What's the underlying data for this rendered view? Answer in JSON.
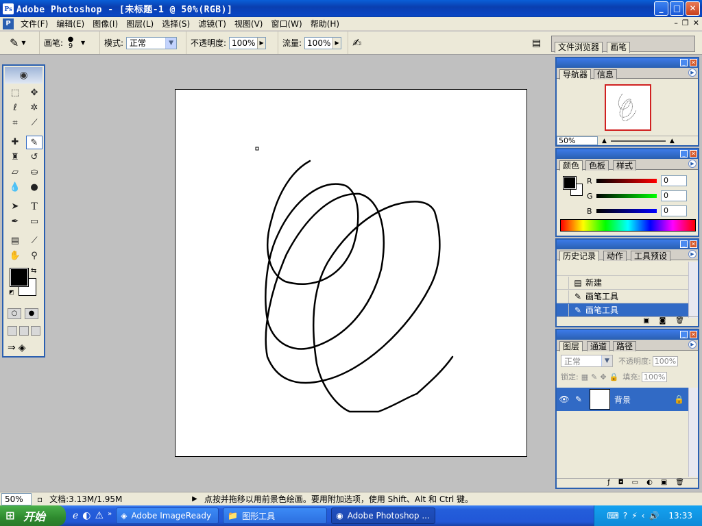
{
  "window": {
    "title": "Adobe Photoshop - [未标题-1 @ 50%(RGB)]",
    "min": "_",
    "max": "□",
    "close": "✕"
  },
  "menu": {
    "items": [
      "文件(F)",
      "编辑(E)",
      "图像(I)",
      "图层(L)",
      "选择(S)",
      "滤镜(T)",
      "视图(V)",
      "窗口(W)",
      "帮助(H)"
    ]
  },
  "options": {
    "brush_label": "画笔:",
    "brush_size": "9",
    "mode_label": "模式:",
    "mode_value": "正常",
    "opacity_label": "不透明度:",
    "opacity_value": "100%",
    "flow_label": "流量:",
    "flow_value": "100%"
  },
  "palette_well": {
    "tabs": [
      "文件浏览器",
      "画笔"
    ]
  },
  "navigator": {
    "tabs": [
      "导航器",
      "信息"
    ],
    "zoom": "50%"
  },
  "color": {
    "tabs": [
      "颜色",
      "色板",
      "样式"
    ],
    "channels": [
      {
        "label": "R",
        "value": "0",
        "color": "#ff0000"
      },
      {
        "label": "G",
        "value": "0",
        "color": "#00ff00"
      },
      {
        "label": "B",
        "value": "0",
        "color": "#0000ff"
      }
    ]
  },
  "history": {
    "tabs": [
      "历史记录",
      "动作",
      "工具预设"
    ],
    "items": [
      {
        "label": "新建",
        "icon": "document-icon"
      },
      {
        "label": "画笔工具",
        "icon": "brush-icon"
      },
      {
        "label": "画笔工具",
        "icon": "brush-icon",
        "selected": true
      }
    ]
  },
  "layers": {
    "tabs": [
      "图层",
      "通道",
      "路径"
    ],
    "blend_mode": "正常",
    "opacity_label": "不透明度:",
    "opacity_value": "100%",
    "lock_label": "锁定:",
    "fill_label": "填充:",
    "fill_value": "100%",
    "layer_name": "背景"
  },
  "status": {
    "zoom": "50%",
    "doc_info": "文档:3.13M/1.95M",
    "hint": "点按并拖移以用前景色绘画。要用附加选项，使用 Shift、Alt 和 Ctrl 键。"
  },
  "taskbar": {
    "start": "开始",
    "tasks": [
      {
        "label": "Adobe ImageReady"
      },
      {
        "label": "图形工具"
      },
      {
        "label": "Adobe Photoshop ..."
      }
    ],
    "clock": "13:33"
  },
  "colors": {
    "accent": "#2a5fb0",
    "selection": "#316ac5",
    "foreground": "#000000",
    "background": "#ffffff"
  }
}
